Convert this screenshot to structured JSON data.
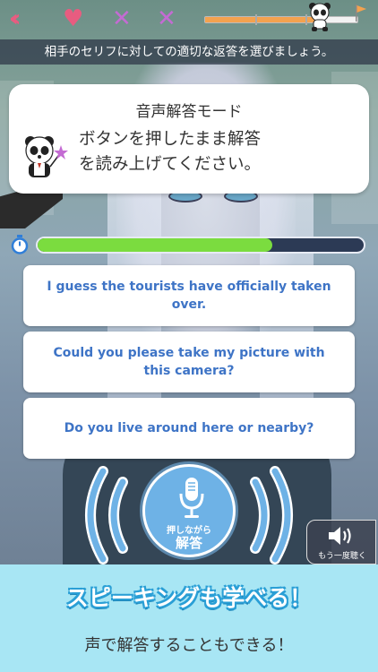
{
  "status": {
    "hearts_remaining": 1,
    "misses": 2,
    "lesson_progress": 0.73
  },
  "instruction": "相手のセリフに対しての適切な返答を選びましょう。",
  "mode_card": {
    "title": "音声解答モード",
    "body_line1": "ボタンを押したまま解答",
    "body_line2": "を読み上げてください。"
  },
  "timer": {
    "remaining_fraction": 0.72
  },
  "choices": [
    "I guess the tourists have officially taken over.",
    "Could you please take my picture with this camera?",
    "Do you live around here or nearby?"
  ],
  "mic": {
    "sub_label": "押しながら",
    "main_label": "解答"
  },
  "replay_label": "もう一度聴く",
  "banner": {
    "title": "スピーキングも学べる！",
    "subtitle": "声で解答することもできる！"
  },
  "colors": {
    "accent_pink": "#e85c80",
    "accent_purple": "#c46bd3",
    "choice_text": "#3e74c6",
    "timer_fill": "#7bdc3f",
    "mic_blue": "#6eb2e6",
    "banner_bg": "#a8e6f4",
    "banner_title_outline": "#2a9fd6"
  },
  "icons": {
    "back": "double-chevron-left",
    "life": "heart",
    "miss": "cross",
    "progress_marker": "panda",
    "goal": "flag",
    "timer": "stopwatch",
    "mic": "microphone",
    "replay": "speaker"
  }
}
